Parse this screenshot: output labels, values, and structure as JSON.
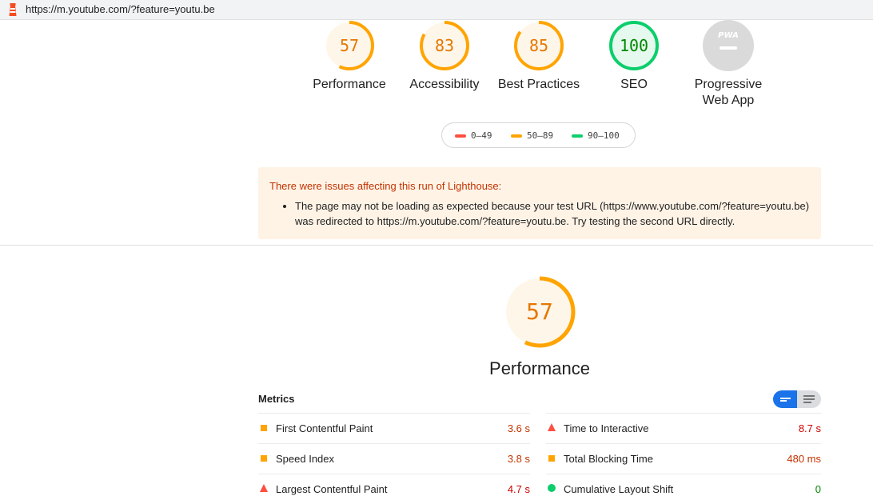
{
  "browser": {
    "url": "https://m.youtube.com/?feature=youtu.be"
  },
  "colors": {
    "fail": "#ff4e42",
    "average": "#ffa400",
    "pass": "#0cce6b",
    "average_text": "#e67700",
    "pass_text": "#008800",
    "fail_text": "#cc0000"
  },
  "categories": [
    {
      "score": "57",
      "label": "Performance",
      "status": "average",
      "fraction": 0.57
    },
    {
      "score": "83",
      "label": "Accessibility",
      "status": "average",
      "fraction": 0.83
    },
    {
      "score": "85",
      "label": "Best Practices",
      "status": "average",
      "fraction": 0.85
    },
    {
      "score": "100",
      "label": "SEO",
      "status": "pass",
      "fraction": 1.0
    },
    {
      "badge": "PWA",
      "label_line1": "Progressive",
      "label_line2": "Web App"
    }
  ],
  "legend": [
    {
      "range": "0–49",
      "status": "fail"
    },
    {
      "range": "50–89",
      "status": "average"
    },
    {
      "range": "90–100",
      "status": "pass"
    }
  ],
  "warning": {
    "title": "There were issues affecting this run of Lighthouse:",
    "line1": "The page may not be loading as expected because your test URL (https://www.youtube.com/?feature=youtu.be)",
    "line2": "was redirected to https://m.youtube.com/?feature=youtu.be. Try testing the second URL directly."
  },
  "performance": {
    "score": "57",
    "fraction": 0.57,
    "label": "Performance"
  },
  "metrics": {
    "header": "Metrics",
    "left": [
      {
        "name": "First Contentful Paint",
        "value": "3.6 s",
        "status": "average"
      },
      {
        "name": "Speed Index",
        "value": "3.8 s",
        "status": "average"
      },
      {
        "name": "Largest Contentful Paint",
        "value": "4.7 s",
        "status": "fail"
      }
    ],
    "right": [
      {
        "name": "Time to Interactive",
        "value": "8.7 s",
        "status": "fail"
      },
      {
        "name": "Total Blocking Time",
        "value": "480 ms",
        "status": "average"
      },
      {
        "name": "Cumulative Layout Shift",
        "value": "0",
        "status": "pass"
      }
    ]
  }
}
